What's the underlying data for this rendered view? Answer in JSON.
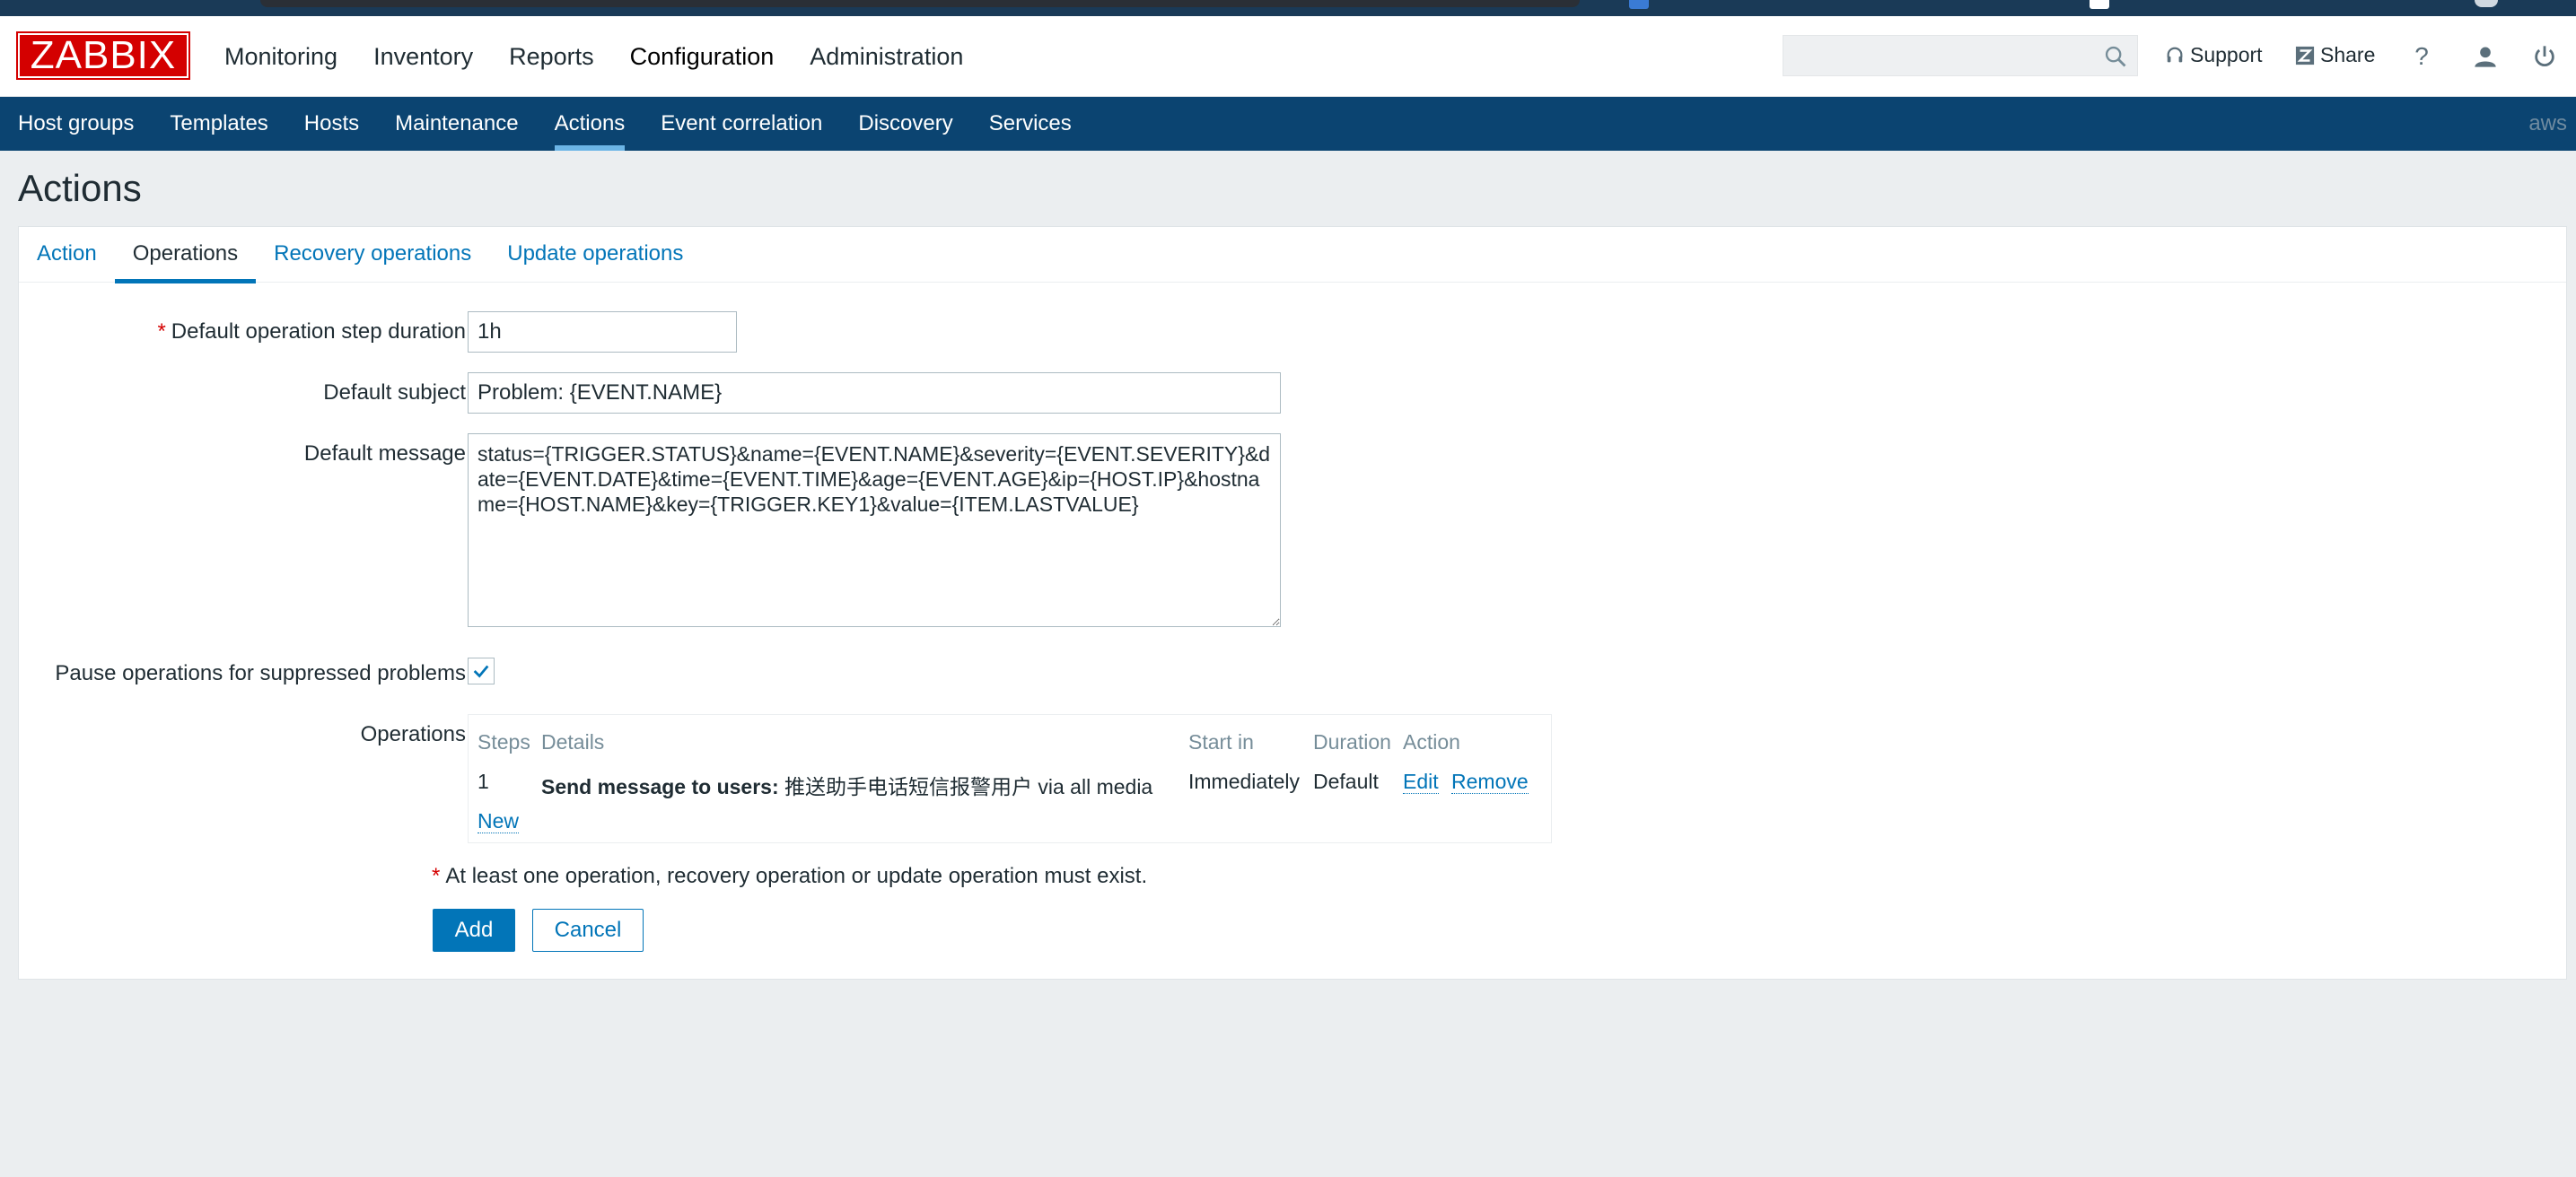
{
  "header": {
    "logo_text": "ZABBIX",
    "main_nav": [
      {
        "label": "Monitoring"
      },
      {
        "label": "Inventory"
      },
      {
        "label": "Reports"
      },
      {
        "label": "Configuration"
      },
      {
        "label": "Administration"
      }
    ],
    "search_value": "",
    "support_label": "Support",
    "share_label": "Share",
    "help_symbol": "?"
  },
  "sub_nav": {
    "items": [
      {
        "label": "Host groups"
      },
      {
        "label": "Templates"
      },
      {
        "label": "Hosts"
      },
      {
        "label": "Maintenance"
      },
      {
        "label": "Actions"
      },
      {
        "label": "Event correlation"
      },
      {
        "label": "Discovery"
      },
      {
        "label": "Services"
      }
    ],
    "server_name": "aws"
  },
  "page_title": "Actions",
  "tabs": [
    {
      "label": "Action"
    },
    {
      "label": "Operations"
    },
    {
      "label": "Recovery operations"
    },
    {
      "label": "Update operations"
    }
  ],
  "form": {
    "step_duration_label": "Default operation step duration",
    "step_duration_value": "1h",
    "subject_label": "Default subject",
    "subject_value": "Problem: {EVENT.NAME}",
    "message_label": "Default message",
    "message_value": "status={TRIGGER.STATUS}&name={EVENT.NAME}&severity={EVENT.SEVERITY}&date={EVENT.DATE}&time={EVENT.TIME}&age={EVENT.AGE}&ip={HOST.IP}&hostname={HOST.NAME}&key={TRIGGER.KEY1}&value={ITEM.LASTVALUE}",
    "pause_label": "Pause operations for suppressed problems",
    "pause_checked": true,
    "operations_label": "Operations"
  },
  "operations_table": {
    "headers": {
      "steps": "Steps",
      "details": "Details",
      "start_in": "Start in",
      "duration": "Duration",
      "action": "Action"
    },
    "rows": [
      {
        "steps": "1",
        "details_bold": "Send message to users:",
        "details_rest": "推送助手电话短信报警用户 via all media",
        "start_in": "Immediately",
        "duration": "Default",
        "edit_label": "Edit",
        "remove_label": "Remove"
      }
    ],
    "new_label": "New"
  },
  "note_text": "At least one operation, recovery operation or update operation must exist.",
  "buttons": {
    "add_label": "Add",
    "cancel_label": "Cancel"
  },
  "colors": {
    "brand_red": "#d40000",
    "nav_blue": "#0b4471",
    "link_blue": "#0275b8",
    "active_underline": "#6cb5e6"
  }
}
